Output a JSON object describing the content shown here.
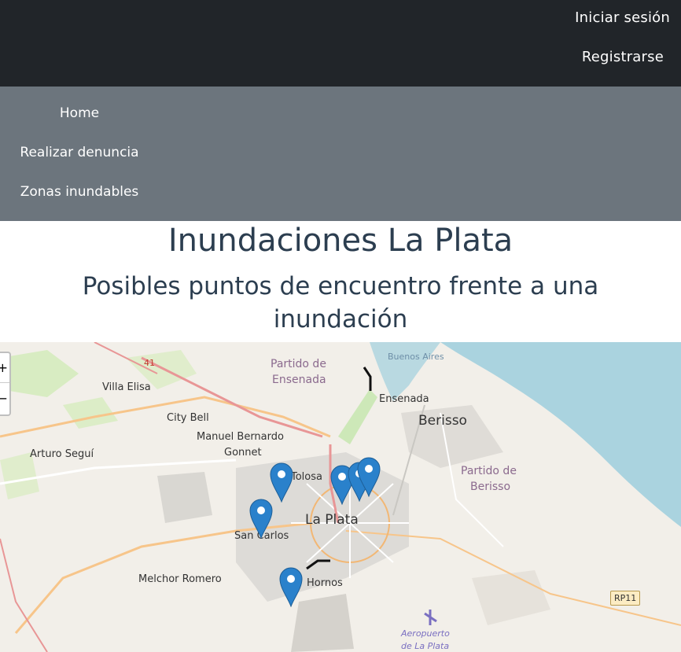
{
  "header": {
    "login_label": "Iniciar sesión",
    "register_label": "Registrarse"
  },
  "nav": {
    "items": [
      {
        "label": "Home"
      },
      {
        "label": "Realizar denuncia"
      },
      {
        "label": "Zonas inundables"
      }
    ]
  },
  "page": {
    "title": "Inundaciones La Plata",
    "subtitle": "Posibles puntos de encuentro frente a una inundación"
  },
  "map": {
    "zoom_in": "+",
    "zoom_out": "−",
    "places": {
      "villa_elisa": "Villa Elisa",
      "city_bell": "City Bell",
      "manuel_bernardo": "Manuel Bernardo",
      "gonnet": "Gonnet",
      "arturo_segui": "Arturo Seguí",
      "tolosa": "Tolosa",
      "la_plata": "La Plata",
      "san_carlos": "San Carlos",
      "melchor_romero": "Melchor Romero",
      "hornos": "Hornos",
      "ensenada": "Ensenada",
      "berisso": "Berisso",
      "buenos_aires": "Buenos Aires",
      "partido_ensenada_1": "Partido de",
      "partido_ensenada_2": "Ensenada",
      "partido_berisso_1": "Partido de",
      "partido_berisso_2": "Berisso",
      "aeropuerto_1": "Aeropuerto",
      "aeropuerto_2": "de La Plata",
      "rp11": "RP11",
      "route41": "41"
    },
    "marker_color": "#2a81cb",
    "water_color": "#aad3df"
  }
}
